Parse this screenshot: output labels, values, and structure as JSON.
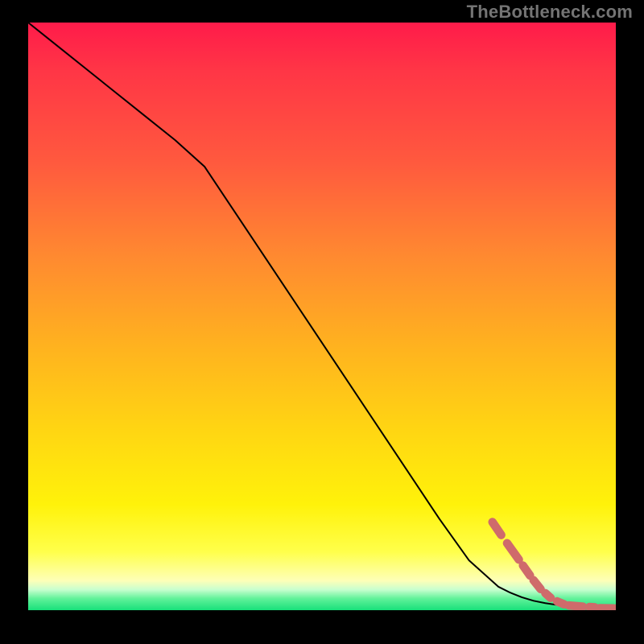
{
  "watermark": "TheBottleneck.com",
  "chart_data": {
    "type": "line",
    "title": "",
    "xlabel": "",
    "ylabel": "",
    "xlim": [
      0,
      100
    ],
    "ylim": [
      0,
      100
    ],
    "grid": false,
    "legend": false,
    "background": "vertical-gradient red→orange→yellow→green (green at y≈0)",
    "series": [
      {
        "name": "curve",
        "stroke": "#000000",
        "x": [
          0,
          5,
          10,
          15,
          20,
          25,
          30,
          35,
          40,
          45,
          50,
          55,
          60,
          65,
          70,
          75,
          80,
          82,
          84,
          86,
          88,
          90,
          92,
          94,
          96,
          98,
          100
        ],
        "y": [
          100,
          96,
          92,
          88,
          84,
          80,
          75.5,
          68,
          60.5,
          53,
          45.5,
          38,
          30.5,
          23,
          15.5,
          8.5,
          4.0,
          3.0,
          2.2,
          1.6,
          1.2,
          0.9,
          0.7,
          0.5,
          0.4,
          0.3,
          0.3
        ]
      }
    ],
    "points": {
      "name": "tail-dashes",
      "color": "#cf6b6b",
      "segments": [
        {
          "x0": 79.0,
          "y0": 15.0,
          "x1": 80.5,
          "y1": 12.8
        },
        {
          "x0": 81.5,
          "y0": 11.4,
          "x1": 83.5,
          "y1": 8.6
        },
        {
          "x0": 84.2,
          "y0": 7.6,
          "x1": 85.4,
          "y1": 5.9
        },
        {
          "x0": 86.0,
          "y0": 5.1,
          "x1": 87.2,
          "y1": 3.6
        },
        {
          "x0": 88.0,
          "y0": 2.9,
          "x1": 88.9,
          "y1": 2.1
        },
        {
          "x0": 90.0,
          "y0": 1.5,
          "x1": 91.2,
          "y1": 1.0
        },
        {
          "x0": 92.0,
          "y0": 0.8,
          "x1": 94.4,
          "y1": 0.6
        },
        {
          "x0": 95.5,
          "y0": 0.55,
          "x1": 96.4,
          "y1": 0.5
        },
        {
          "x0": 97.2,
          "y0": 0.35,
          "x1": 99.6,
          "y1": 0.3
        }
      ],
      "end_dot": {
        "x": 100.0,
        "y": 0.3
      }
    }
  }
}
